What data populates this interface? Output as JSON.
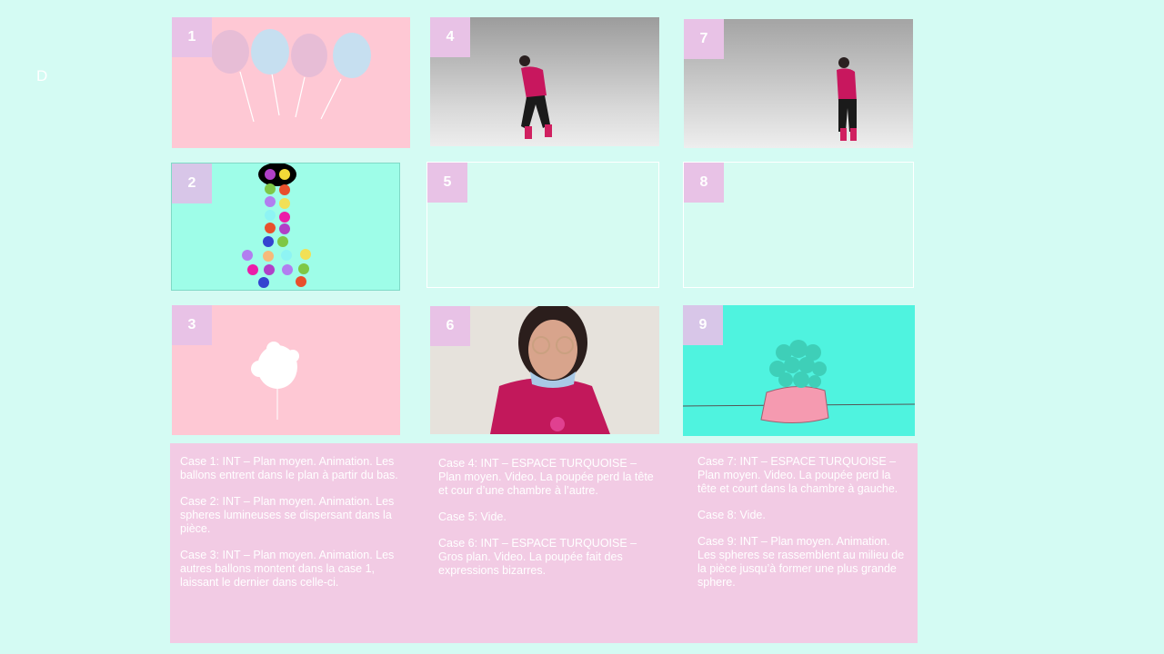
{
  "corner_mark": "D",
  "panels": [
    {
      "number": "1",
      "content": "balloons-animation"
    },
    {
      "number": "2",
      "content": "spheres-animation"
    },
    {
      "number": "3",
      "content": "single-balloon-animation"
    },
    {
      "number": "4",
      "content": "video-dancer"
    },
    {
      "number": "5",
      "content": "empty"
    },
    {
      "number": "6",
      "content": "video-closeup"
    },
    {
      "number": "7",
      "content": "video-dancer"
    },
    {
      "number": "8",
      "content": "empty"
    },
    {
      "number": "9",
      "content": "large-sphere-animation"
    }
  ],
  "descriptions": {
    "col1": [
      "Case 1: INT – Plan moyen. Animation.  Les ballons entrent dans le plan à partir du  bas.",
      "Case 2: INT – Plan moyen. Animation.  Les spheres lumineuses se dispersant dans la pièce.",
      "Case 3: INT – Plan moyen. Animation.  Les autres ballons montent  dans la case 1, laissant le dernier dans celle-ci."
    ],
    "col2": [
      "Case 4: INT – ESPACE TURQUOISE – Plan moyen.  Video. La poupée perd la tête et cour d’une chambre à l’autre.",
      "Case 5: Vide.",
      "Case 6: INT – ESPACE TURQUOISE – Gros plan. Video.  La poupée  fait des expressions bizarres."
    ],
    "col3": [
      "Case 7: INT – ESPACE TURQUOISE – Plan moyen. Video. La poupée perd la tête et court dans la chambre à gauche.",
      "Case 8: Vide.",
      "Case 9: INT – Plan moyen. Animation.  Les spheres se rassemblent au milieu de la pièce jusqu’à former  une plus grande sphere."
    ]
  },
  "colors": {
    "background": "#d4fbf3",
    "pink_panel": "#fec8d4",
    "mint_panel": "#9efde8",
    "turquoise_panel": "#4ff3df",
    "number_badge": "#e8c2e6",
    "text_box": "#f2cbe4"
  }
}
